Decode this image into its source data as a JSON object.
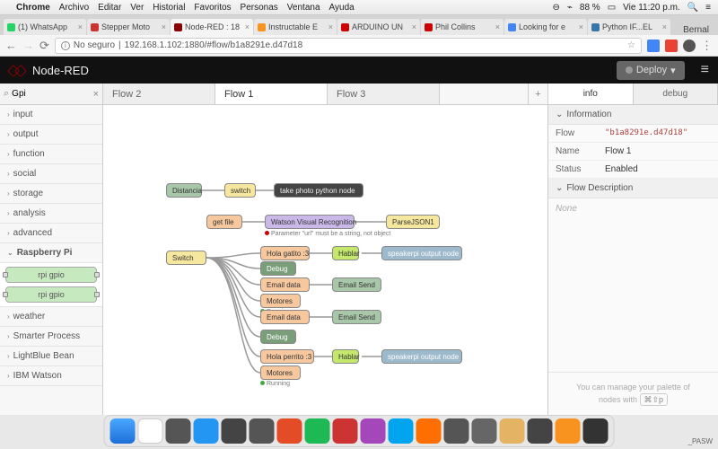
{
  "mac_menu": {
    "app": "Chrome",
    "items": [
      "Archivo",
      "Editar",
      "Ver",
      "Historial",
      "Favoritos",
      "Personas",
      "Ventana",
      "Ayuda"
    ],
    "right": {
      "battery": "88 %",
      "time": "Vie 11:20 p.m."
    }
  },
  "chrome": {
    "tabs": [
      {
        "label": "(1) WhatsApp"
      },
      {
        "label": "Stepper Moto"
      },
      {
        "label": "Node-RED : 18",
        "active": true
      },
      {
        "label": "Instructable E"
      },
      {
        "label": "ARDUINO UN"
      },
      {
        "label": "Phil Collins"
      },
      {
        "label": "Looking for e"
      },
      {
        "label": "Python IF...EL"
      }
    ],
    "user": "Bernal",
    "url_prefix": "No seguro",
    "url": "192.168.1.102:1880/#flow/b1a8291e.d47d18"
  },
  "nodered": {
    "title": "Node-RED",
    "deploy": "Deploy",
    "palette_search": "Gpi",
    "palette": [
      {
        "label": "input"
      },
      {
        "label": "output"
      },
      {
        "label": "function"
      },
      {
        "label": "social"
      },
      {
        "label": "storage"
      },
      {
        "label": "analysis"
      },
      {
        "label": "advanced"
      },
      {
        "label": "Raspberry Pi",
        "open": true,
        "nodes": [
          "rpi gpio",
          "rpi gpio"
        ]
      },
      {
        "label": "weather"
      },
      {
        "label": "Smarter Process"
      },
      {
        "label": "LightBlue Bean"
      },
      {
        "label": "IBM Watson"
      }
    ],
    "ws_tabs": [
      "Flow 2",
      "Flow 1",
      "Flow 3"
    ],
    "ws_active": 1,
    "sidebar": {
      "tabs": [
        "info",
        "debug"
      ],
      "section1": "Information",
      "rows": [
        {
          "k": "Flow",
          "v": "\"b1a8291e.d47d18\"",
          "code": true
        },
        {
          "k": "Name",
          "v": "Flow 1"
        },
        {
          "k": "Status",
          "v": "Enabled"
        }
      ],
      "section2": "Flow Description",
      "desc": "None",
      "footer_a": "You can manage your palette of",
      "footer_b": "nodes with",
      "footer_kbd": "⌘⇧p"
    },
    "canvas_nodes": {
      "distancia": "Distancia",
      "switch": "switch",
      "take_photo": "take photo python node",
      "get_file": "get file",
      "watson": "Watson Visual Recognition",
      "parsejson": "ParseJSON1",
      "watson_err": "Parameter \"url\" must be a string, not object",
      "switch2": "Switch",
      "hola_gatito": "Hola gatito :3",
      "hablar": "Hablar",
      "speaker": "speakerpi output node",
      "debug": "Debug",
      "email_data": "Email data",
      "email_send": "Email Send",
      "motores": "Motores",
      "running": "Running",
      "hola_perrito": "Hola perrito :3"
    }
  },
  "corner": "_PASW"
}
